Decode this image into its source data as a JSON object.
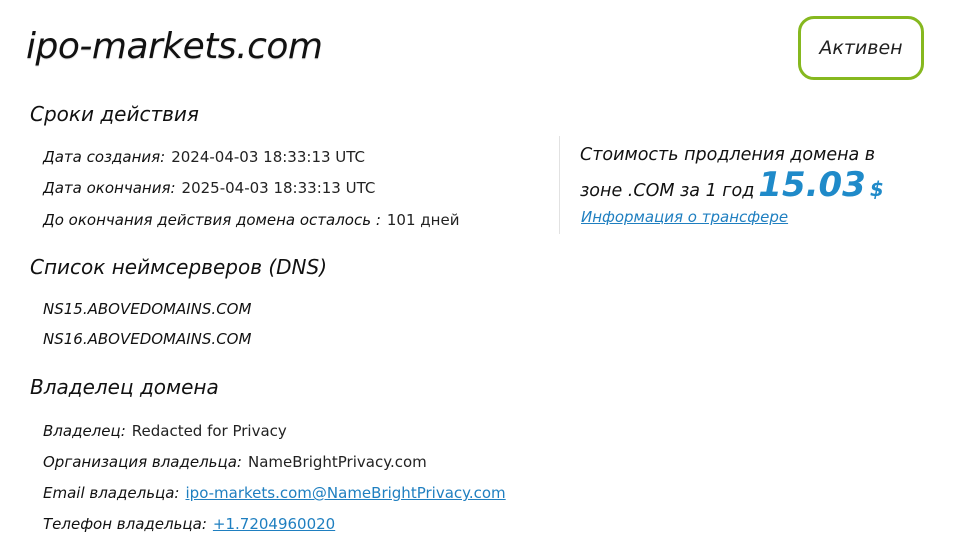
{
  "domain": "ipo-markets.com",
  "status": "Активен",
  "validity": {
    "title": "Сроки действия",
    "created_label": "Дата создания:",
    "created_value": "2024-04-03 18:33:13 UTC",
    "expires_label": "Дата окончания:",
    "expires_value": "2025-04-03 18:33:13 UTC",
    "remaining_label": "До окончания действия домена осталось :",
    "remaining_value": "101 дней"
  },
  "dns": {
    "title": "Список неймсерверов (DNS)",
    "servers": [
      "NS15.ABOVEDOMAINS.COM",
      "NS16.ABOVEDOMAINS.COM"
    ]
  },
  "owner": {
    "title": "Владелец домена",
    "owner_label": "Владелец:",
    "owner_value": "Redacted for Privacy",
    "org_label": "Организация владельца:",
    "org_value": "NameBrightPrivacy.com",
    "email_label": "Email владельца:",
    "email_value": "ipo-markets.com@NameBrightPrivacy.com",
    "phone_label": "Телефон владельца:",
    "phone_value": "+1.7204960020"
  },
  "renewal": {
    "text": "Стоимость продления домена в зоне .COM за 1 год",
    "price": "15.03",
    "currency": "$",
    "transfer_link": "Информация о трансфере"
  },
  "colors": {
    "accent_green": "#86b81f",
    "link_blue": "#1f7fc0",
    "price_blue": "#1f8ac9"
  }
}
